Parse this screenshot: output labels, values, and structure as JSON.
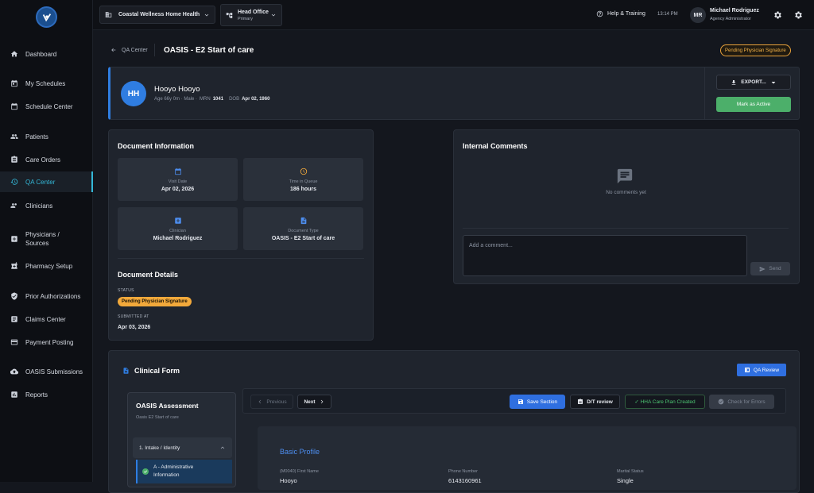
{
  "sidebar": {
    "items": [
      {
        "label": "Dashboard",
        "icon": "home-icon"
      },
      {
        "label": "My Schedules",
        "icon": "calendar-icon"
      },
      {
        "label": "Schedule Center",
        "icon": "calendar-grid-icon"
      },
      {
        "label": "Patients",
        "icon": "people-icon"
      },
      {
        "label": "Care Orders",
        "icon": "clipboard-icon"
      },
      {
        "label": "QA Center",
        "icon": "history-icon"
      },
      {
        "label": "Clinicians",
        "icon": "group-icon"
      },
      {
        "label": "Physicians /",
        "label2": "Sources",
        "icon": "medical-plus-icon"
      },
      {
        "label": "Pharmacy Setup",
        "icon": "pharmacy-icon"
      },
      {
        "label": "Prior Authorizations",
        "icon": "shield-check-icon"
      },
      {
        "label": "Claims Center",
        "icon": "list-icon"
      },
      {
        "label": "Payment Posting",
        "icon": "credit-card-icon"
      },
      {
        "label": "OASIS Submissions",
        "icon": "cloud-upload-icon"
      },
      {
        "label": "Reports",
        "icon": "bar-chart-icon"
      }
    ],
    "active_index": 5
  },
  "topbar": {
    "organization": "Coastal Wellness Home Health",
    "office_name": "Head Office",
    "office_type": "Primary",
    "help_label": "Help & Training",
    "time": "13:14 PM",
    "user_initials": "MR",
    "user_name": "Michael Rodriguez",
    "user_role": "Agency Administrator"
  },
  "page": {
    "back_label": "QA Center",
    "title": "OASIS - E2 Start of care",
    "status_badge": "Pending Physician Signature"
  },
  "patient": {
    "initials": "HH",
    "name": "Hooyo Hooyo",
    "demographics": "Age 66y 0m · Male ·",
    "mrn_label": "MRN",
    "mrn": "1041",
    "dob_label": "DOB",
    "dob": "Apr 02, 1960",
    "export_label": "EXPORT...",
    "mark_active_label": "Mark as Active"
  },
  "document_info": {
    "title": "Document Information",
    "tiles": [
      {
        "label": "Visit Date",
        "value": "Apr 02, 2026",
        "icon": "calendar-icon",
        "color": "#4d8ef0"
      },
      {
        "label": "Time in Queue",
        "value": "186 hours",
        "icon": "clock-icon",
        "color": "#f2a93b"
      },
      {
        "label": "Clinician",
        "value": "Michael Rodriguez",
        "icon": "medical-plus-icon",
        "color": "#4d8ef0"
      },
      {
        "label": "Document Type",
        "value": "OASIS - E2 Start of care",
        "icon": "document-icon",
        "color": "#4d8ef0"
      }
    ]
  },
  "document_details": {
    "title": "Document Details",
    "status_label": "STATUS",
    "status_value": "Pending Physician Signature",
    "submitted_label": "SUBMITTED AT",
    "submitted_value": "Apr 03, 2026"
  },
  "comments": {
    "title": "Internal Comments",
    "empty_text": "No comments yet",
    "placeholder": "Add a comment...",
    "send_label": "Send"
  },
  "clinical_form": {
    "title": "Clinical Form",
    "qa_review_label": "QA Review",
    "assessment_title": "OASIS Assessment",
    "assessment_subtitle": "Oasis E2 Start of care",
    "section": "1. Intake / Identity",
    "subsection_line1": "A - Administrative",
    "subsection_line2": "Information",
    "toolbar": {
      "previous": "Previous",
      "next": "Next",
      "save": "Save Section",
      "dt_review": "D/T review",
      "hha": "✓ HHA Care Plan Created",
      "check_errors": "Check for Errors"
    },
    "section_title": "Basic Profile",
    "fields": [
      {
        "label": "(M0040) First Name",
        "value": "Hooyo"
      },
      {
        "label": "Phone Number",
        "value": "6143160961"
      },
      {
        "label": "Marital Status",
        "value": "Single"
      }
    ]
  }
}
